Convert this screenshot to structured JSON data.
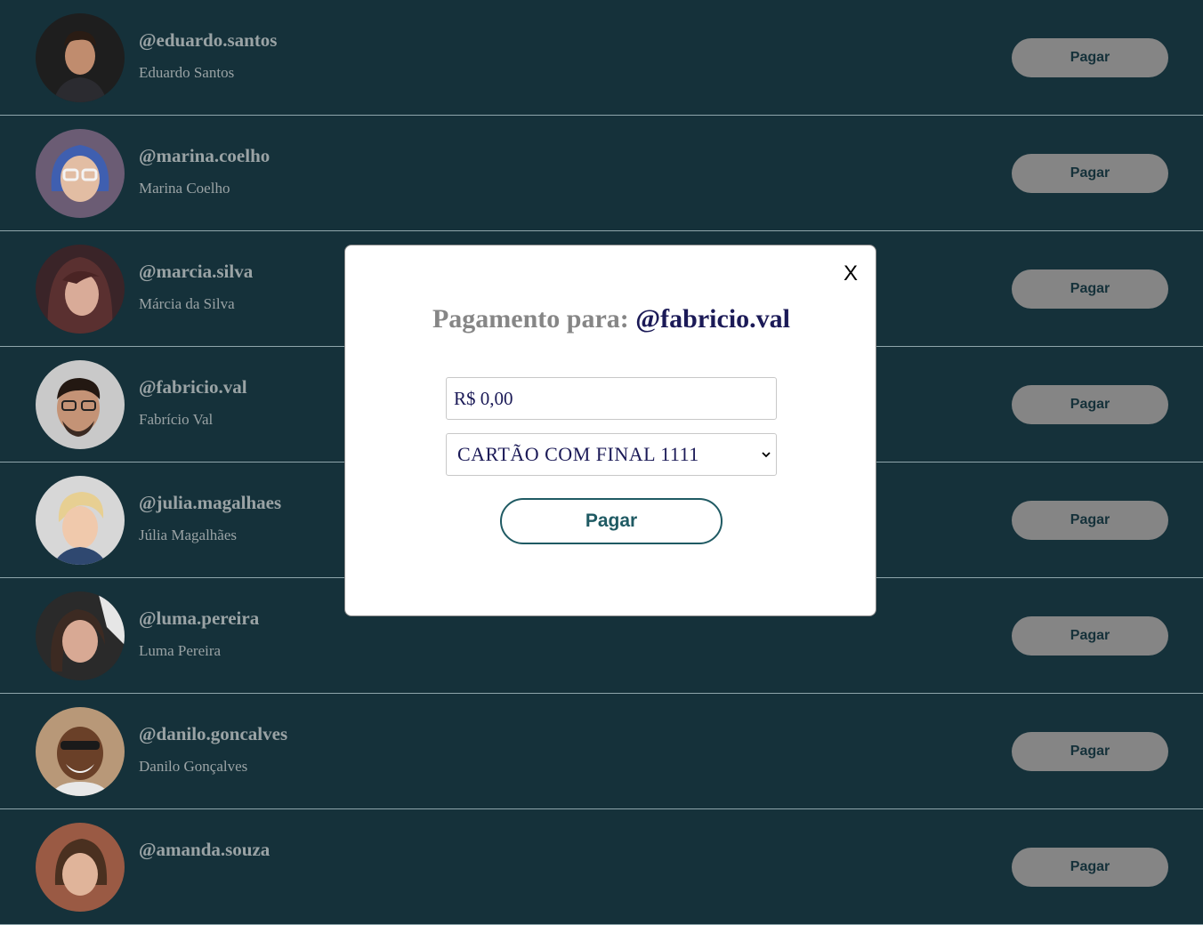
{
  "users": [
    {
      "handle": "@eduardo.santos",
      "name": "Eduardo Santos",
      "pay_label": "Pagar"
    },
    {
      "handle": "@marina.coelho",
      "name": "Marina Coelho",
      "pay_label": "Pagar"
    },
    {
      "handle": "@marcia.silva",
      "name": "Márcia da Silva",
      "pay_label": "Pagar"
    },
    {
      "handle": "@fabricio.val",
      "name": "Fabrício Val",
      "pay_label": "Pagar"
    },
    {
      "handle": "@julia.magalhaes",
      "name": "Júlia Magalhães",
      "pay_label": "Pagar"
    },
    {
      "handle": "@luma.pereira",
      "name": "Luma Pereira",
      "pay_label": "Pagar"
    },
    {
      "handle": "@danilo.goncalves",
      "name": "Danilo Gonçalves",
      "pay_label": "Pagar"
    },
    {
      "handle": "@amanda.souza",
      "name": "",
      "pay_label": "Pagar"
    }
  ],
  "modal": {
    "close_label": "X",
    "title_prefix": "Pagamento para:",
    "title_user": "@fabricio.val",
    "amount_value": "R$ 0,00",
    "card_selected": "CARTÃO COM FINAL 1111",
    "pay_label": "Pagar"
  },
  "colors": {
    "background": "#15313a",
    "row_button": "#858585",
    "modal_accent": "#1f5a63",
    "title_user": "#1b1a57"
  }
}
